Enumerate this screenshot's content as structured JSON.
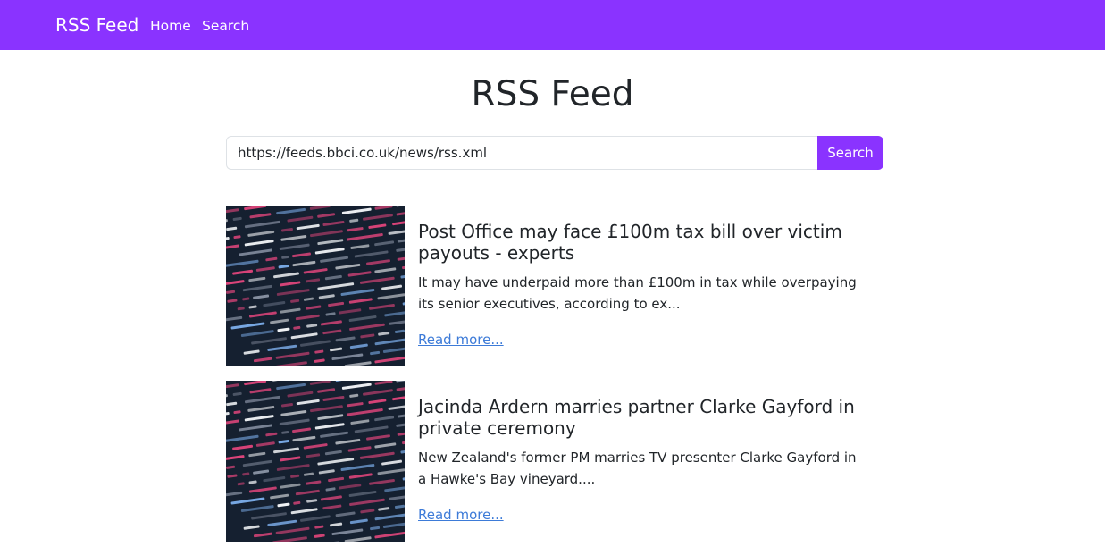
{
  "navbar": {
    "brand": "RSS Feed",
    "links": [
      "Home",
      "Search"
    ],
    "color": "#8a33ff"
  },
  "main": {
    "title": "RSS Feed",
    "search": {
      "value": "https://feeds.bbci.co.uk/news/rss.xml",
      "button_label": "Search"
    },
    "articles": [
      {
        "title": "Post Office may face £100m tax bill over victim payouts - experts",
        "description": "It may have underpaid more than £100m in tax while overpaying its senior executives, according to ex...",
        "link_label": "Read more...",
        "image": "code-screenshot-thumbnail"
      },
      {
        "title": "Jacinda Ardern marries partner Clarke Gayford in private ceremony",
        "description": "New Zealand's former PM marries TV presenter Clarke Gayford in a Hawke's Bay vineyard....",
        "link_label": "Read more...",
        "image": "code-screenshot-thumbnail"
      }
    ]
  }
}
